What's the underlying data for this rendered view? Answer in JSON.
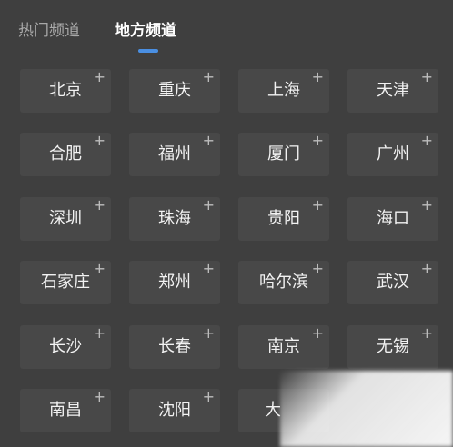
{
  "tabs": {
    "hot": "热门频道",
    "local": "地方频道"
  },
  "add_symbol": "+",
  "channels": [
    "北京",
    "重庆",
    "上海",
    "天津",
    "合肥",
    "福州",
    "厦门",
    "广州",
    "深圳",
    "珠海",
    "贵阳",
    "海口",
    "石家庄",
    "郑州",
    "哈尔滨",
    "武汉",
    "长沙",
    "长春",
    "南京",
    "无锡",
    "南昌",
    "沈阳",
    "大"
  ],
  "colors": {
    "background": "#3f3f3f",
    "chip": "#484848",
    "accent": "#4a8fe2"
  }
}
